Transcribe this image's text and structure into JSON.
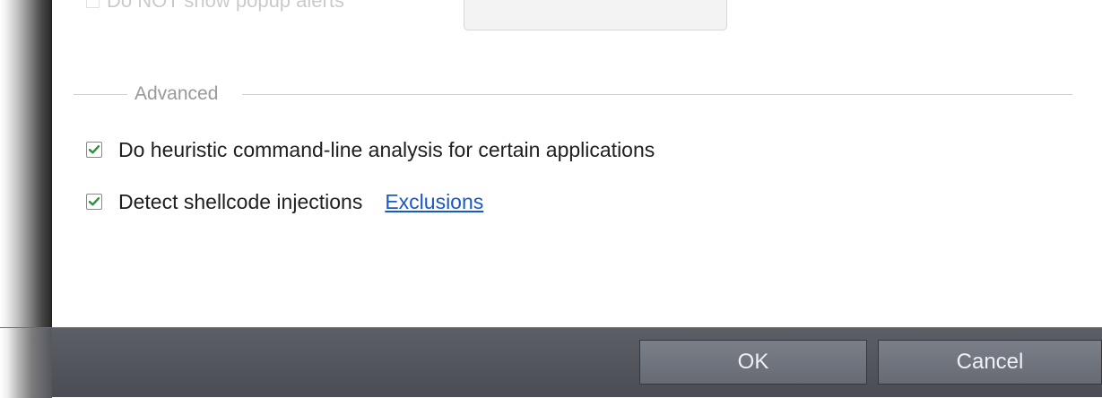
{
  "advanced": {
    "title": "Advanced",
    "options": [
      {
        "label": "Do heuristic command-line analysis for certain applications",
        "checked": true
      },
      {
        "label": "Detect shellcode injections",
        "checked": true,
        "link": "Exclusions"
      }
    ]
  },
  "top_partial": {
    "label": "Do NOT show popup alerts"
  },
  "footer": {
    "ok_label": "OK",
    "cancel_label": "Cancel"
  },
  "colors": {
    "link": "#1a58c9",
    "checkmark": "#2f8f3f",
    "footer_bg": "#4f5259",
    "button_bg": "#6f737b"
  }
}
